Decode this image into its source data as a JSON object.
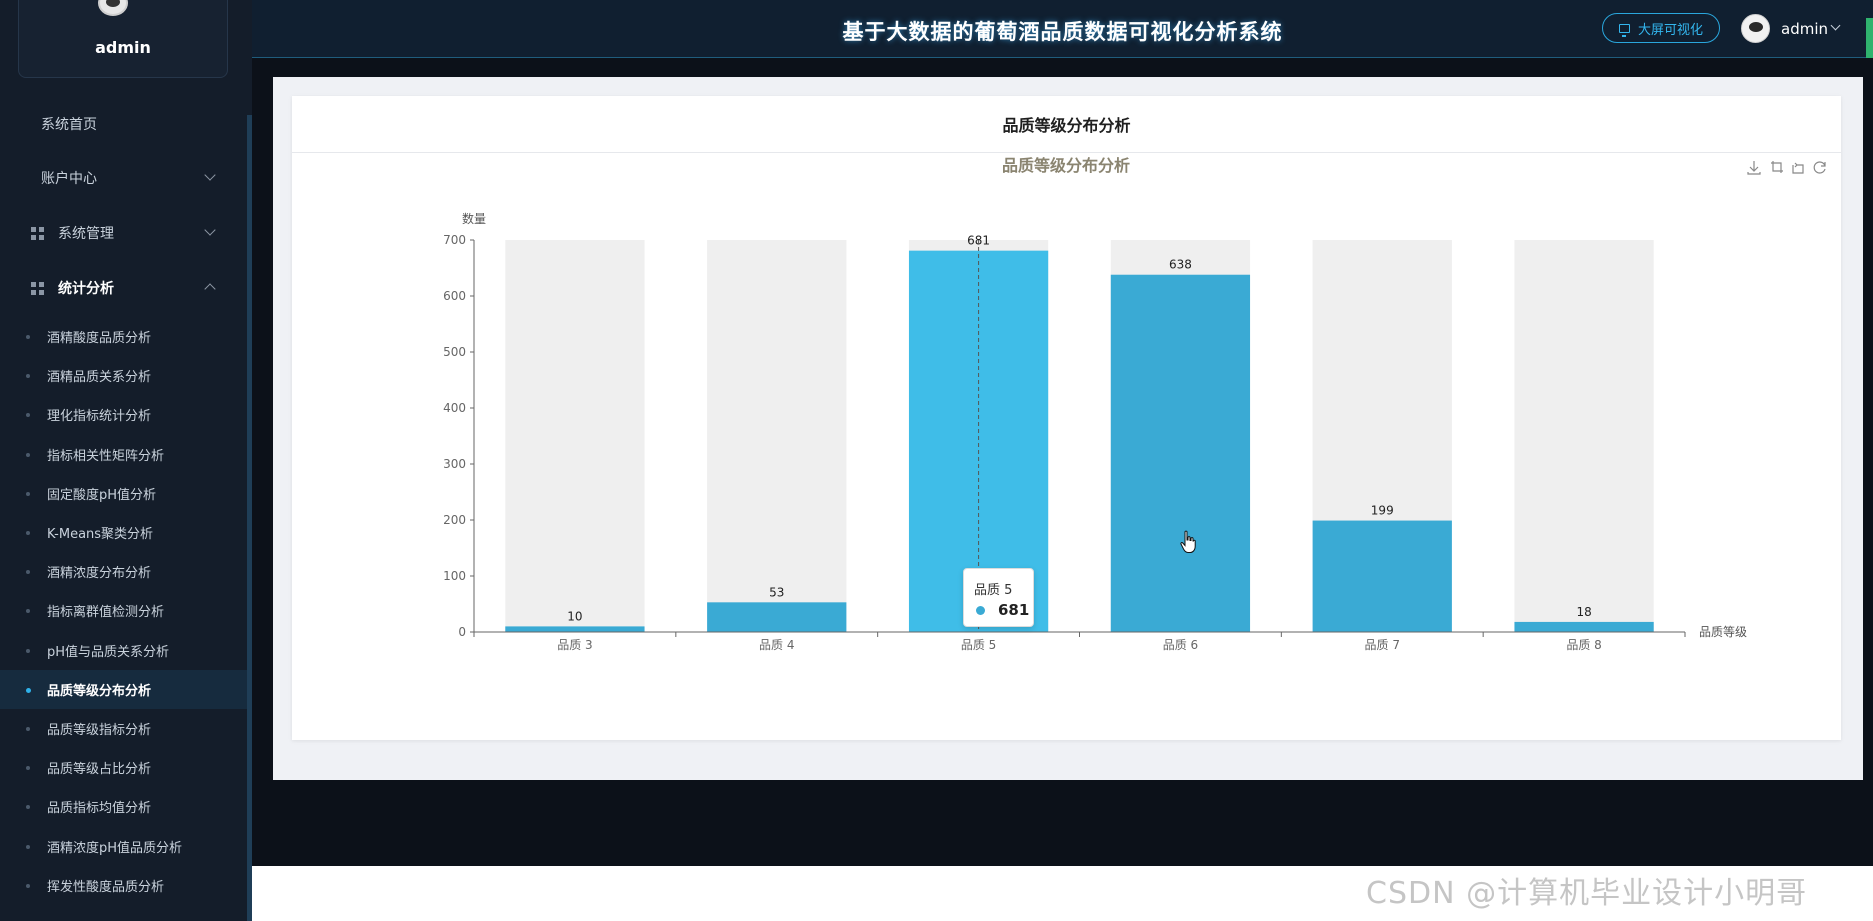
{
  "sidebar": {
    "username": "admin",
    "menu": [
      {
        "label": "系统首页"
      },
      {
        "label": "账户中心"
      },
      {
        "label": "系统管理"
      },
      {
        "label": "统计分析"
      }
    ],
    "sub_items": [
      {
        "label": "酒精酸度品质分析"
      },
      {
        "label": "酒精品质关系分析"
      },
      {
        "label": "理化指标统计分析"
      },
      {
        "label": "指标相关性矩阵分析"
      },
      {
        "label": "固定酸度pH值分析"
      },
      {
        "label": "K-Means聚类分析"
      },
      {
        "label": "酒精浓度分布分析"
      },
      {
        "label": "指标离群值检测分析"
      },
      {
        "label": "pH值与品质关系分析"
      },
      {
        "label": "品质等级分布分析"
      },
      {
        "label": "品质等级指标分析"
      },
      {
        "label": "品质等级占比分析"
      },
      {
        "label": "品质指标均值分析"
      },
      {
        "label": "酒精浓度pH值品质分析"
      },
      {
        "label": "挥发性酸度品质分析"
      }
    ],
    "active_sub": 9
  },
  "header": {
    "title": "基于大数据的葡萄酒品质数据可视化分析系统",
    "bigscreen_label": "大屏可视化",
    "username": "admin"
  },
  "card": {
    "title": "品质等级分布分析"
  },
  "chart_data": {
    "type": "bar",
    "title": "品质等级分布分析",
    "xlabel": "品质等级",
    "ylabel": "数量",
    "categories": [
      "品质 3",
      "品质 4",
      "品质 5",
      "品质 6",
      "品质 7",
      "品质 8"
    ],
    "values": [
      10,
      53,
      681,
      638,
      199,
      18
    ],
    "ylim": [
      0,
      700
    ],
    "yticks": [
      0,
      100,
      200,
      300,
      400,
      500,
      600,
      700
    ],
    "bar_color": "#3aaad4",
    "highlight_color": "#3fbde8",
    "background_bar_color": "#efefef",
    "highlighted_index": 2,
    "grid": false
  },
  "tooltip": {
    "title": "品质 5",
    "value": "681"
  },
  "watermark": "CSDN @计算机毕业设计小明哥"
}
